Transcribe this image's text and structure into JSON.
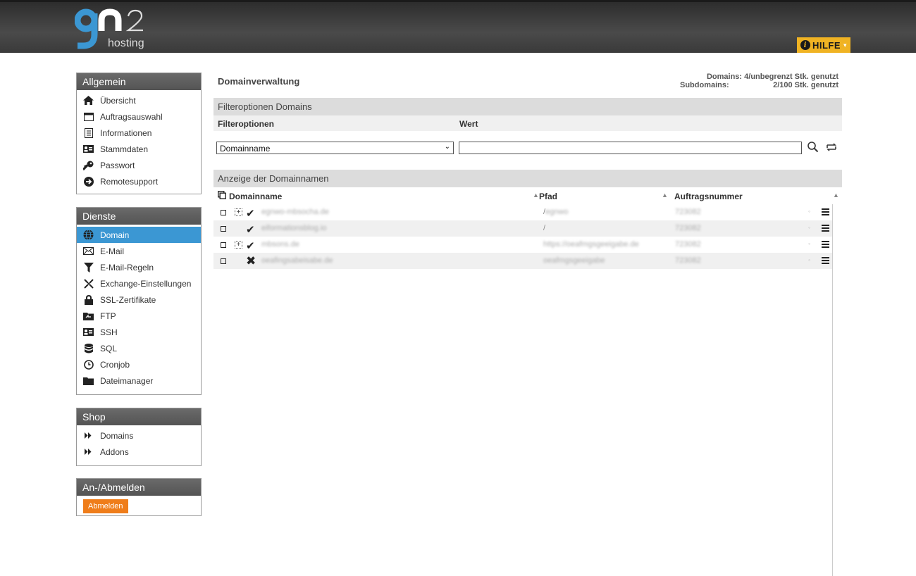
{
  "header": {
    "logo_text": "gn2",
    "logo_subtitle": "hosting",
    "help_label": "HILFE"
  },
  "sidebar": {
    "allgemein": {
      "title": "Allgemein",
      "items": [
        {
          "label": "Übersicht",
          "icon": "home-icon"
        },
        {
          "label": "Auftragsauswahl",
          "icon": "window-icon"
        },
        {
          "label": "Informationen",
          "icon": "document-icon"
        },
        {
          "label": "Stammdaten",
          "icon": "id-card-icon"
        },
        {
          "label": "Passwort",
          "icon": "key-icon"
        },
        {
          "label": "Remotesupport",
          "icon": "arrow-circle-icon"
        }
      ]
    },
    "dienste": {
      "title": "Dienste",
      "items": [
        {
          "label": "Domain",
          "icon": "globe-icon",
          "active": true
        },
        {
          "label": "E-Mail",
          "icon": "envelope-icon"
        },
        {
          "label": "E-Mail-Regeln",
          "icon": "filter-icon"
        },
        {
          "label": "Exchange-Einstellungen",
          "icon": "exchange-icon"
        },
        {
          "label": "SSL-Zertifikate",
          "icon": "lock-icon"
        },
        {
          "label": "FTP",
          "icon": "ftp-icon"
        },
        {
          "label": "SSH",
          "icon": "terminal-icon"
        },
        {
          "label": "SQL",
          "icon": "database-icon"
        },
        {
          "label": "Cronjob",
          "icon": "clock-icon"
        },
        {
          "label": "Dateimanager",
          "icon": "folder-icon"
        }
      ]
    },
    "shop": {
      "title": "Shop",
      "items": [
        {
          "label": "Domains",
          "icon": "double-chevron-icon"
        },
        {
          "label": "Addons",
          "icon": "double-chevron-icon"
        }
      ]
    },
    "auth": {
      "title": "An-/Abmelden",
      "logout_label": "Abmelden"
    }
  },
  "main": {
    "title": "Domainverwaltung",
    "usage": {
      "domains_label": "Domains:",
      "domains_value": "4/unbegrenzt Stk. genutzt",
      "subdomains_label": "Subdomains:",
      "subdomains_value": "2/100 Stk. genutzt"
    },
    "filter": {
      "section_title": "Filteroptionen Domains",
      "col_filter": "Filteroptionen",
      "col_value": "Wert",
      "selected_option": "Domainname",
      "value": ""
    },
    "table": {
      "section_title": "Anzeige der Domainnamen",
      "columns": [
        "Domainname",
        "Pfad",
        "Auftragsnummer"
      ],
      "rows": [
        {
          "expandable": true,
          "status": "ok",
          "domain": "egnwo-mbsocha.de",
          "pfad_prefix": "/",
          "pfad": "egnwo",
          "auftrag": "723082"
        },
        {
          "expandable": false,
          "status": "ok",
          "domain": "eiformationsblog.io",
          "pfad_prefix": "/",
          "pfad": "",
          "auftrag": "723082"
        },
        {
          "expandable": true,
          "status": "ok",
          "domain": "mbsons.de",
          "pfad_prefix": "",
          "pfad": "https://oeafmgsgeeigabe.de",
          "auftrag": "723082"
        },
        {
          "expandable": false,
          "status": "error",
          "domain": "oeafingsabeisabe.de",
          "pfad_prefix": "",
          "pfad": "oeafmgsgeeigabe",
          "auftrag": "723082"
        }
      ]
    }
  },
  "colors": {
    "accent_blue": "#3b97d3",
    "help_yellow": "#f0b323",
    "logout_orange": "#ef7d1a",
    "header_dark": "#3a3a3a"
  }
}
